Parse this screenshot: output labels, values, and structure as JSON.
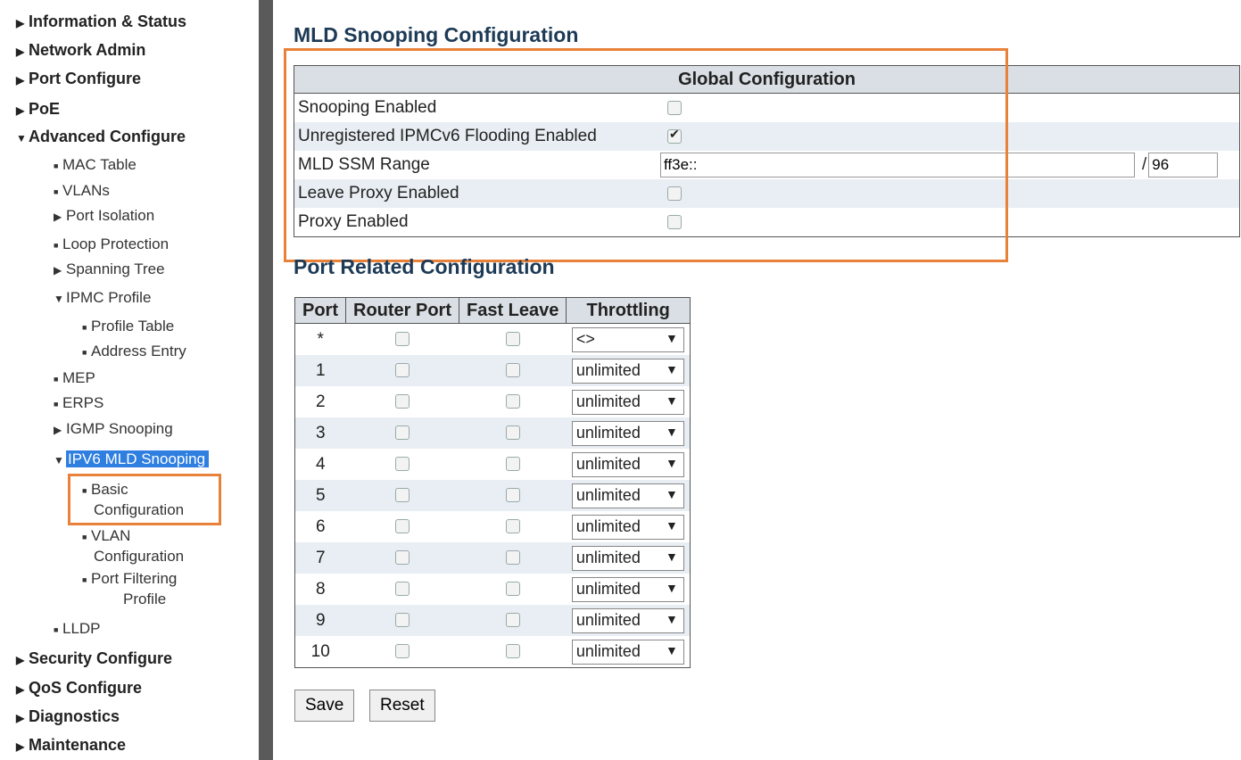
{
  "sidebar": {
    "items": [
      {
        "label": "Information & Status",
        "arrow": "▶"
      },
      {
        "label": "Network Admin",
        "arrow": "▶"
      },
      {
        "label": "Port Configure",
        "arrow": "▶"
      },
      {
        "label": "PoE",
        "arrow": "▶"
      },
      {
        "label": "Advanced Configure",
        "arrow": "▼"
      },
      {
        "label": "MAC Table",
        "bullet": "■"
      },
      {
        "label": "VLANs",
        "bullet": "■"
      },
      {
        "label": "Port Isolation",
        "arrow": "▶"
      },
      {
        "label": "Loop Protection",
        "bullet": "■"
      },
      {
        "label": "Spanning Tree",
        "arrow": "▶"
      },
      {
        "label": "IPMC Profile",
        "arrow": "▼"
      },
      {
        "label": "Profile Table",
        "bullet": "■"
      },
      {
        "label": "Address Entry",
        "bullet": "■"
      },
      {
        "label": "MEP",
        "bullet": "■"
      },
      {
        "label": "ERPS",
        "bullet": "■"
      },
      {
        "label": "IGMP Snooping",
        "arrow": "▶"
      },
      {
        "label": "IPV6 MLD Snooping",
        "arrow": "▼"
      },
      {
        "label": "Basic",
        "label2": "Configuration",
        "bullet": "■"
      },
      {
        "label": "VLAN",
        "label2": "Configuration",
        "bullet": "■"
      },
      {
        "label": "Port Filtering",
        "label2": "Profile",
        "bullet": "■"
      },
      {
        "label": "LLDP",
        "bullet": "■"
      },
      {
        "label": "Security Configure",
        "arrow": "▶"
      },
      {
        "label": "QoS Configure",
        "arrow": "▶"
      },
      {
        "label": "Diagnostics",
        "arrow": "▶"
      },
      {
        "label": "Maintenance",
        "arrow": "▶"
      }
    ]
  },
  "main": {
    "title": "MLD Snooping Configuration",
    "global": {
      "header": "Global Configuration",
      "rows": [
        {
          "label": "Snooping Enabled",
          "checked": false
        },
        {
          "label": "Unregistered IPMCv6 Flooding Enabled",
          "checked": true
        },
        {
          "label": "MLD SSM Range",
          "value": "ff3e::",
          "separator": "/",
          "prefix": "96"
        },
        {
          "label": "Leave Proxy Enabled",
          "checked": false
        },
        {
          "label": "Proxy Enabled",
          "checked": false
        }
      ]
    },
    "port_section_title": "Port Related Configuration",
    "port_table": {
      "headers": [
        "Port",
        "Router Port",
        "Fast Leave",
        "Throttling"
      ],
      "rows": [
        {
          "port": "*",
          "throttling": "<>"
        },
        {
          "port": "1",
          "throttling": "unlimited"
        },
        {
          "port": "2",
          "throttling": "unlimited"
        },
        {
          "port": "3",
          "throttling": "unlimited"
        },
        {
          "port": "4",
          "throttling": "unlimited"
        },
        {
          "port": "5",
          "throttling": "unlimited"
        },
        {
          "port": "6",
          "throttling": "unlimited"
        },
        {
          "port": "7",
          "throttling": "unlimited"
        },
        {
          "port": "8",
          "throttling": "unlimited"
        },
        {
          "port": "9",
          "throttling": "unlimited"
        },
        {
          "port": "10",
          "throttling": "unlimited"
        }
      ]
    },
    "buttons": {
      "save": "Save",
      "reset": "Reset"
    }
  },
  "colors": {
    "highlight": "#e8823a",
    "selected": "#2f7fe0",
    "header_bg": "#d9dfe4",
    "alt_row": "#e8eef3"
  }
}
